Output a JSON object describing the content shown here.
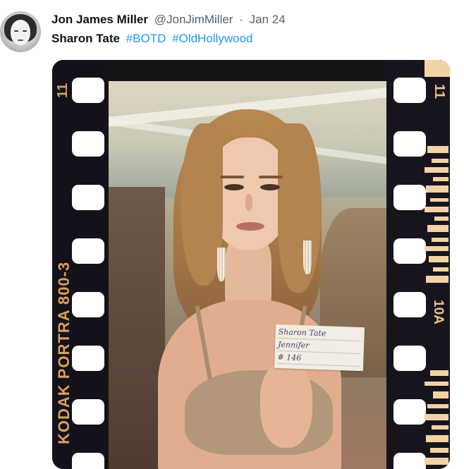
{
  "post": {
    "author_name": "Jon James Miller",
    "handle": "@JonJimMiller",
    "separator": "·",
    "date": "Jan 24",
    "text_bold": "Sharon Tate",
    "hashtags": [
      "#BOTD",
      "#OldHollywood"
    ]
  },
  "media": {
    "film_brand_text": "KODAK PORTRA 800-3",
    "frame_number_left": "11",
    "frame_number_right": "11",
    "frame_code_right": "10A",
    "card_lines": [
      "Sharon Tate",
      "Jennifer",
      "# 146"
    ],
    "colors": {
      "film_base": "#14111a",
      "edge_print": "#d8a15a",
      "sprocket_hole": "#ffffff"
    }
  },
  "colors": {
    "link": "#1d9bf0",
    "text_primary": "#0f1419",
    "text_secondary": "#536471"
  },
  "icons": {
    "avatar": "author-avatar"
  }
}
